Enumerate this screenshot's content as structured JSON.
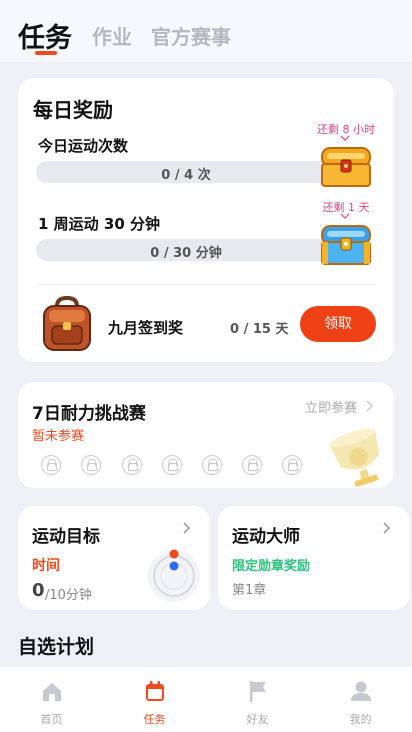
{
  "tabs": [
    {
      "label": "任务",
      "active": true
    },
    {
      "label": "作业",
      "active": false
    },
    {
      "label": "官方赛事",
      "active": false
    }
  ],
  "daily": {
    "title": "每日奖励",
    "tasks": [
      {
        "label": "今日运动次数",
        "progress_text": "0 / 4 次",
        "progress": 0,
        "chest_note": "还剩 8 小时",
        "chest": "gold-chest-icon"
      },
      {
        "label": "1 周运动 30 分钟",
        "progress_text": "0 / 30 分钟",
        "progress": 0,
        "chest_note": "还剩 1 天",
        "chest": "blue-chest-icon"
      }
    ],
    "checkin": {
      "label": "九月签到奖",
      "progress_text": "0 / 15 天",
      "button": "领取"
    }
  },
  "challenge": {
    "title": "7日耐力挑战赛",
    "status": "暂未参赛",
    "join": "立即参赛",
    "lock_count": 7
  },
  "goal": {
    "title": "运动目标",
    "sub": "时间",
    "value": "0",
    "unit": "/10分钟"
  },
  "master": {
    "title": "运动大师",
    "sub": "限定勋章奖励",
    "chapter": "第1章"
  },
  "plans_title": "自选计划",
  "nav": [
    {
      "label": "首页",
      "icon": "home-icon",
      "active": false
    },
    {
      "label": "任务",
      "icon": "calendar-icon",
      "active": true
    },
    {
      "label": "好友",
      "icon": "flag-icon",
      "active": false
    },
    {
      "label": "我的",
      "icon": "person-icon",
      "active": false
    }
  ],
  "colors": {
    "accent": "#f04a1f",
    "pink": "#e0457a",
    "green": "#2ec27e",
    "inactive": "#b6b8bf"
  }
}
